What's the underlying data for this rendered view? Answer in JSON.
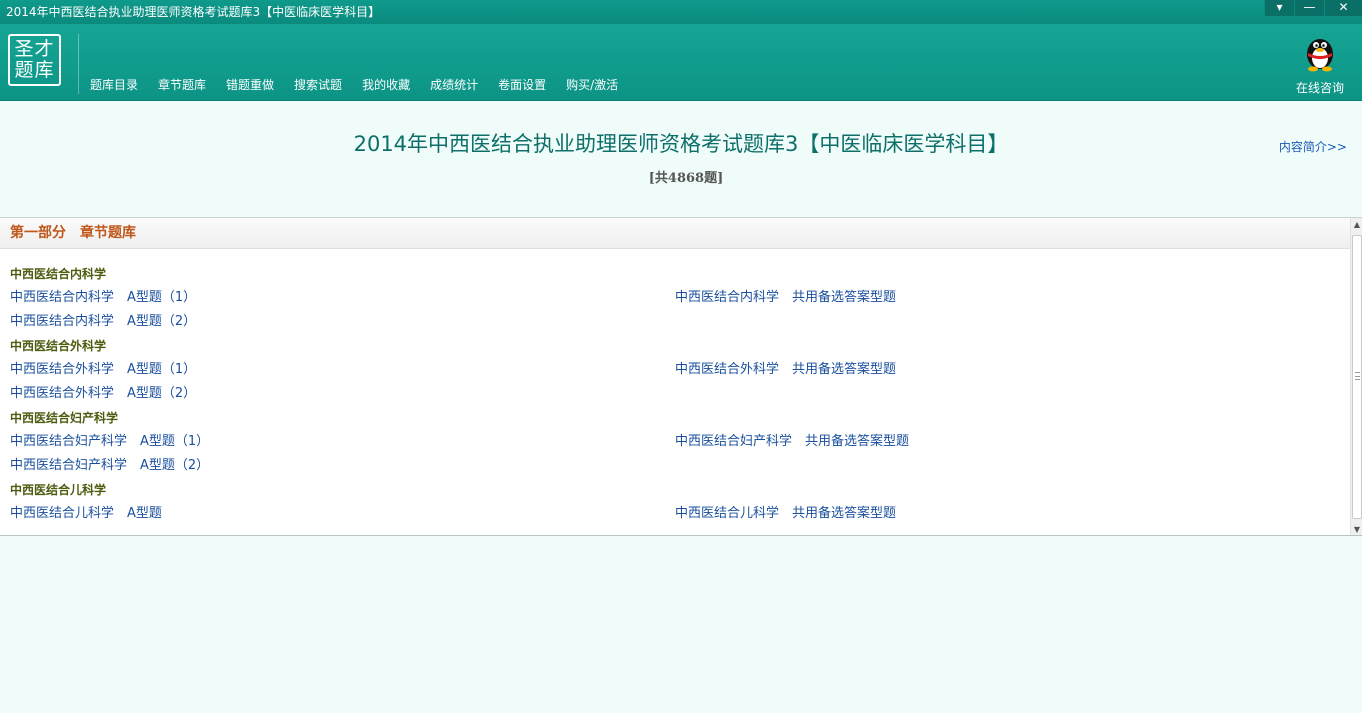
{
  "window": {
    "title": "2014年中西医结合执业助理医师资格考试题库3【中医临床医学科目】",
    "buttons": [
      "▾",
      "—",
      "✕"
    ]
  },
  "logo": {
    "line1": "圣才",
    "line2": "题库"
  },
  "nav": {
    "items": [
      "题库目录",
      "章节题库",
      "错题重做",
      "搜索试题",
      "我的收藏",
      "成绩统计",
      "卷面设置",
      "购买/激活"
    ]
  },
  "consult": {
    "label": "在线咨询"
  },
  "header": {
    "title": "2014年中西医结合执业助理医师资格考试题库3【中医临床医学科目】",
    "count": "[共4868题]",
    "intro_link": "内容简介>>"
  },
  "section": {
    "part": "第一部分",
    "name": "章节题库"
  },
  "categories": [
    {
      "name": "中西医结合内科学",
      "rows": [
        {
          "left": "中西医结合内科学　A型题（1）",
          "right": "中西医结合内科学　共用备选答案型题"
        },
        {
          "left": "中西医结合内科学　A型题（2）",
          "right": ""
        }
      ]
    },
    {
      "name": "中西医结合外科学",
      "rows": [
        {
          "left": "中西医结合外科学　A型题（1）",
          "right": "中西医结合外科学　共用备选答案型题"
        },
        {
          "left": "中西医结合外科学　A型题（2）",
          "right": ""
        }
      ]
    },
    {
      "name": "中西医结合妇产科学",
      "rows": [
        {
          "left": "中西医结合妇产科学　A型题（1）",
          "right": "中西医结合妇产科学　共用备选答案型题"
        },
        {
          "left": "中西医结合妇产科学　A型题（2）",
          "right": ""
        }
      ]
    },
    {
      "name": "中西医结合儿科学",
      "rows": [
        {
          "left": "中西医结合儿科学　A型题",
          "right": "中西医结合儿科学　共用备选答案型题"
        }
      ]
    }
  ],
  "colors": {
    "accent": "#0f9a8c",
    "link": "#1a4f9e",
    "section": "#c0571a",
    "category": "#4d5d10"
  }
}
